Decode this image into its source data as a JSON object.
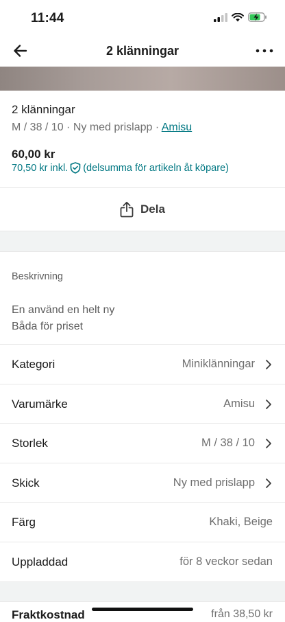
{
  "status": {
    "time": "11:44"
  },
  "nav": {
    "title": "2 klänningar"
  },
  "item": {
    "title": "2 klänningar",
    "meta": "M / 38 / 10 · Ny med prislapp · ",
    "brand": "Amisu",
    "price": "60,00 kr",
    "price_incl": "70,50 kr inkl.",
    "price_incl_note": "(delsumma för artikeln åt köpare)"
  },
  "share": {
    "label": "Dela"
  },
  "description": {
    "heading": "Beskrivning",
    "line1": "En använd en helt ny",
    "line2": "Båda för priset"
  },
  "details": [
    {
      "label": "Kategori",
      "value": "Miniklänningar"
    },
    {
      "label": "Varumärke",
      "value": "Amisu"
    },
    {
      "label": "Storlek",
      "value": "M / 38 / 10"
    },
    {
      "label": "Skick",
      "value": "Ny med prislapp"
    },
    {
      "label": "Färg",
      "value": "Khaki, Beige"
    },
    {
      "label": "Uppladdad",
      "value": "för 8 veckor sedan"
    }
  ],
  "shipping": {
    "label": "Fraktkostnad",
    "value": "från 38,50 kr"
  },
  "colors": {
    "accent": "#007782",
    "band": "#f1f3f3"
  }
}
